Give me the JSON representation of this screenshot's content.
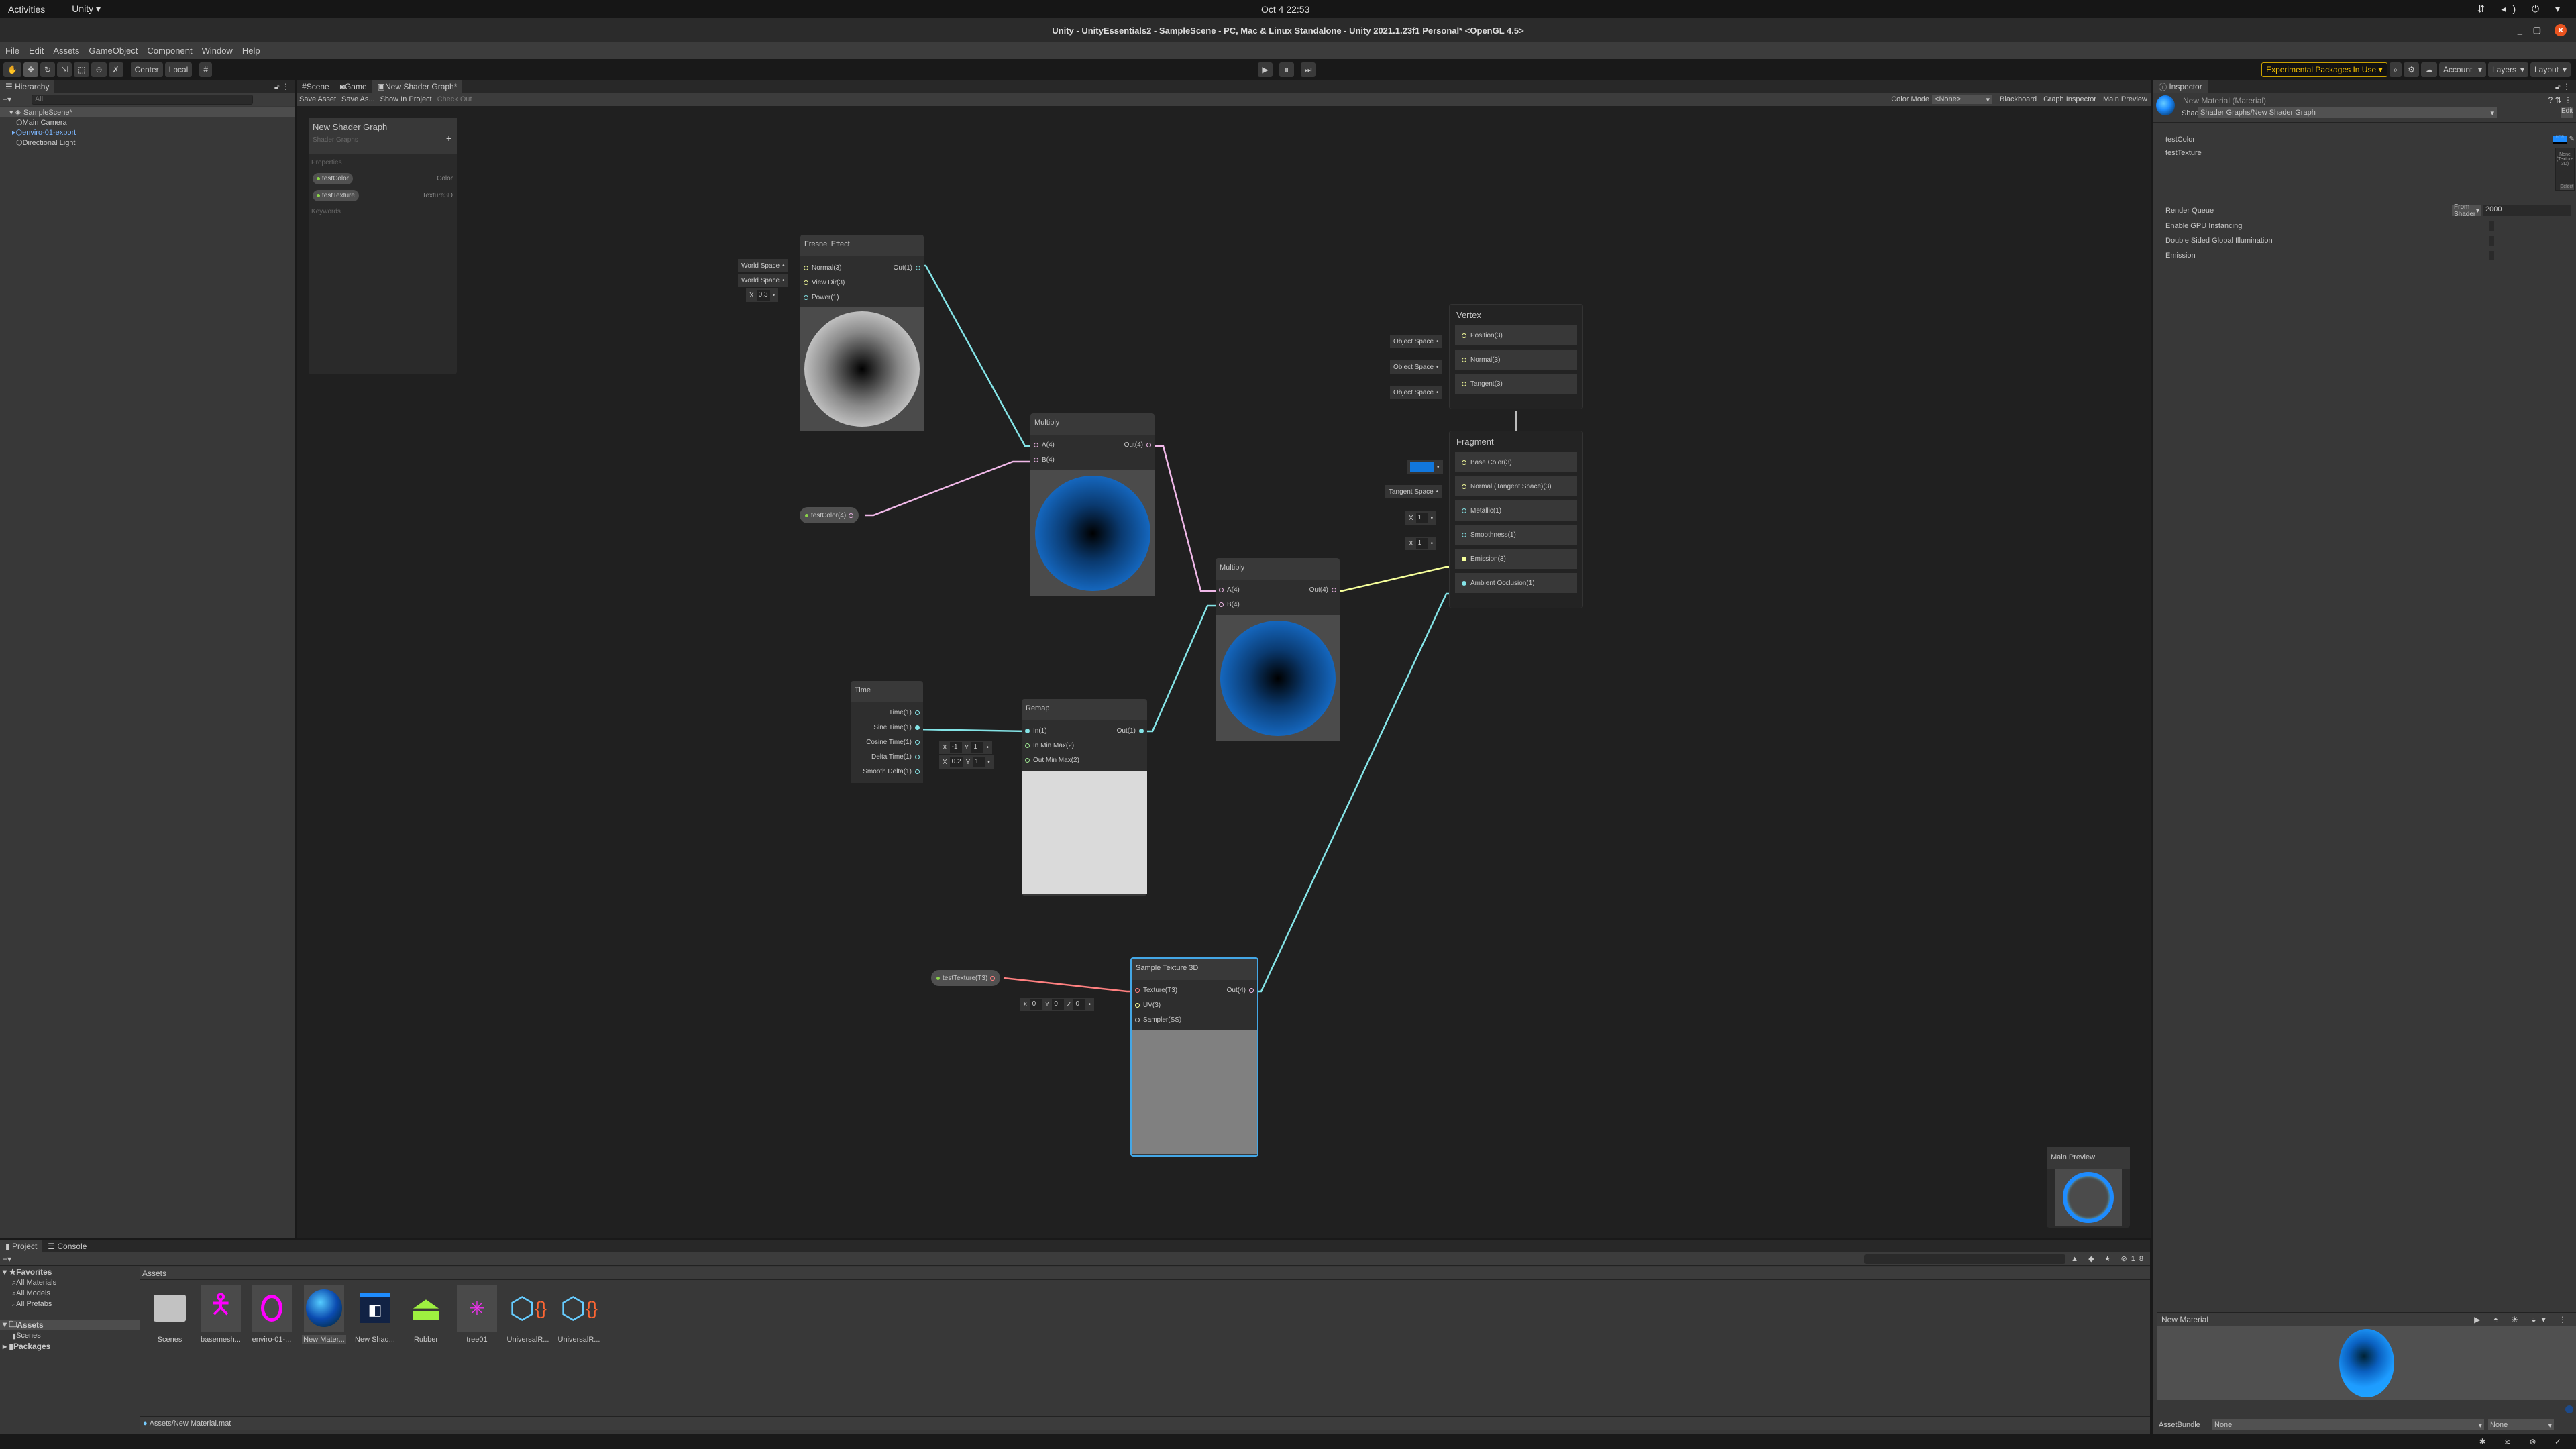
{
  "os": {
    "activities": "Activities",
    "app": "Unity ▾",
    "clock": "Oct 4  22:53"
  },
  "window": {
    "title": "Unity - UnityEssentials2 - SampleScene - PC, Mac & Linux Standalone - Unity 2021.1.23f1 Personal* <OpenGL 4.5>"
  },
  "menu": [
    "File",
    "Edit",
    "Assets",
    "GameObject",
    "Component",
    "Window",
    "Help"
  ],
  "toolbar": {
    "pivot": "Center",
    "space": "Local",
    "experimental": "Experimental Packages In Use ▾",
    "account": "Account",
    "layers": "Layers",
    "layout": "Layout"
  },
  "hierarchy": {
    "tab": "Hierarchy",
    "search_placeholder": "All",
    "scene": "SampleScene*",
    "items": [
      "Main Camera",
      "enviro-01-export",
      "Directional Light"
    ]
  },
  "center_tabs": [
    "Scene",
    "Game",
    "New Shader Graph*"
  ],
  "graph_toolbar": {
    "save": "Save Asset",
    "save_as": "Save As...",
    "show": "Show In Project",
    "checkout": "Check Out",
    "color_mode_label": "Color Mode",
    "color_mode": "<None>",
    "blackboard": "Blackboard",
    "graph_inspector": "Graph Inspector",
    "main_preview": "Main Preview"
  },
  "blackboard": {
    "title": "New Shader Graph",
    "subtitle": "Shader Graphs",
    "properties_label": "Properties",
    "keywords_label": "Keywords",
    "properties": [
      {
        "name": "testColor",
        "type": "Color"
      },
      {
        "name": "testTexture",
        "type": "Texture3D"
      }
    ]
  },
  "nodes": {
    "fresnel": {
      "title": "Fresnel Effect",
      "inputs": [
        "Normal(3)",
        "View Dir(3)",
        "Power(1)"
      ],
      "output": "Out(1)",
      "defaults": [
        "World Space",
        "World Space"
      ],
      "power": "0.3"
    },
    "multiply1": {
      "title": "Multiply",
      "inputs": [
        "A(4)",
        "B(4)"
      ],
      "output": "Out(4)"
    },
    "multiply2": {
      "title": "Multiply",
      "inputs": [
        "A(4)",
        "B(4)"
      ],
      "output": "Out(4)"
    },
    "test_color": "testColor(4)",
    "time": {
      "title": "Time",
      "outputs": [
        "Time(1)",
        "Sine Time(1)",
        "Cosine Time(1)",
        "Delta Time(1)",
        "Smooth Delta(1)"
      ]
    },
    "remap": {
      "title": "Remap",
      "inputs": [
        "In(1)",
        "In Min Max(2)",
        "Out Min Max(2)"
      ],
      "output": "Out(1)",
      "in_min": "-1",
      "in_max": "1",
      "out_min": "0.2",
      "out_max": "1"
    },
    "sample": {
      "title": "Sample Texture 3D",
      "inputs": [
        "Texture(T3)",
        "UV(3)",
        "Sampler(SS)"
      ],
      "output": "Out(4)",
      "uv": [
        "0",
        "0",
        "0"
      ]
    },
    "test_texture": "testTexture(T3)",
    "vertex": {
      "title": "Vertex",
      "slots": [
        "Position(3)",
        "Normal(3)",
        "Tangent(3)"
      ],
      "space": "Object Space"
    },
    "fragment": {
      "title": "Fragment",
      "slots": [
        "Base Color(3)",
        "Normal (Tangent Space)(3)",
        "Metallic(1)",
        "Smoothness(1)",
        "Emission(3)",
        "Ambient Occlusion(1)"
      ],
      "normal_space": "Tangent Space",
      "metallic": "1",
      "smoothness": "1",
      "base_color": "#1177dd"
    },
    "main_preview": "Main Preview"
  },
  "inspector": {
    "tab": "Inspector",
    "material": "New Material (Material)",
    "shader_label": "Shader",
    "shader": "Shader Graphs/New Shader Graph",
    "edit": "Edit...",
    "props": [
      {
        "label": "testColor",
        "hdr": "HDR"
      },
      {
        "label": "testTexture",
        "value": "None (Texture 3D)",
        "select": "Select"
      }
    ],
    "render_queue": "Render Queue",
    "rq_mode": "From Shader",
    "rq_value": "2000",
    "toggles": [
      "Enable GPU Instancing",
      "Double Sided Global Illumination",
      "Emission"
    ],
    "preview_title": "New Material",
    "asset_bundle": "AssetBundle",
    "bundle": "None",
    "variant": "None"
  },
  "project": {
    "tabs": [
      "Project",
      "Console"
    ],
    "favorites": "Favorites",
    "fav_items": [
      "All Materials",
      "All Models",
      "All Prefabs"
    ],
    "assets": "Assets",
    "scenes": "Scenes",
    "packages": "Packages",
    "breadcrumb": "Assets",
    "hidden_count": "18",
    "items": [
      "Scenes",
      "basemesh...",
      "enviro-01-...",
      "New Mater...",
      "New Shad...",
      "Rubber",
      "tree01",
      "UniversalR...",
      "UniversalR..."
    ],
    "path": "Assets/New Material.mat"
  },
  "colors": {
    "accent": "#1e8cff",
    "edge_float": "#84e4e7",
    "edge_vec4": "#f0b8e8",
    "edge_tex": "#ff8080",
    "edge_vec3": "#f6ff9a"
  }
}
